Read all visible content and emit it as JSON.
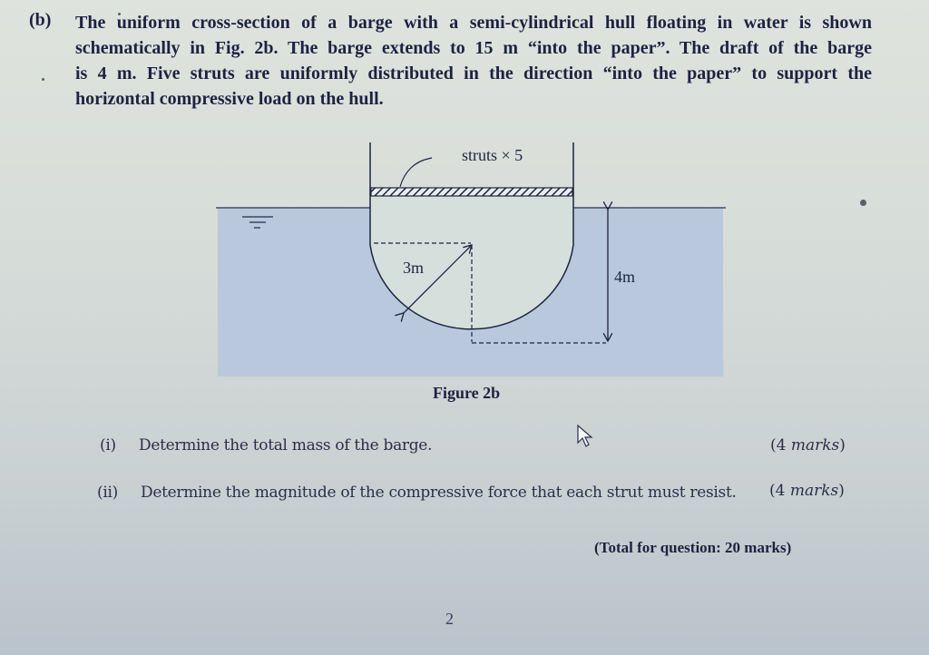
{
  "question": {
    "label": "(b)",
    "lines": [
      "The uniform cross-section of a barge with a semi-cylindrical hull floating in water is shown",
      "schematically in Fig. 2b.  The barge extends to 15 m “into the paper”.  The draft of the barge",
      "is 4 m.  Five struts are uniformly distributed in the direction “into the paper” to support the",
      "horizontal compressive load on the hull."
    ]
  },
  "figure": {
    "struts_label": "struts × 5",
    "radius_label": "3m",
    "draft_label": "4m",
    "caption": "Figure 2b",
    "colors": {
      "water": "#b7c7dc",
      "line": "#1f2440",
      "hull_interior": "#d3dfdc"
    }
  },
  "subquestions": [
    {
      "number": "(i)",
      "text": "Determine the total mass of the barge.",
      "marks_num": "(4",
      "marks_word": "marks",
      "marks_close": ")"
    },
    {
      "number": "(ii)",
      "text": "Determine the magnitude of the compressive force that each strut must resist.",
      "marks_num": "(4",
      "marks_word": "marks",
      "marks_close": ")"
    }
  ],
  "total": "(Total for question:  20 marks)",
  "page_number": "2",
  "icons": {
    "cursor": "mouse-pointer-icon",
    "water_level": "water-surface-symbol-icon"
  }
}
